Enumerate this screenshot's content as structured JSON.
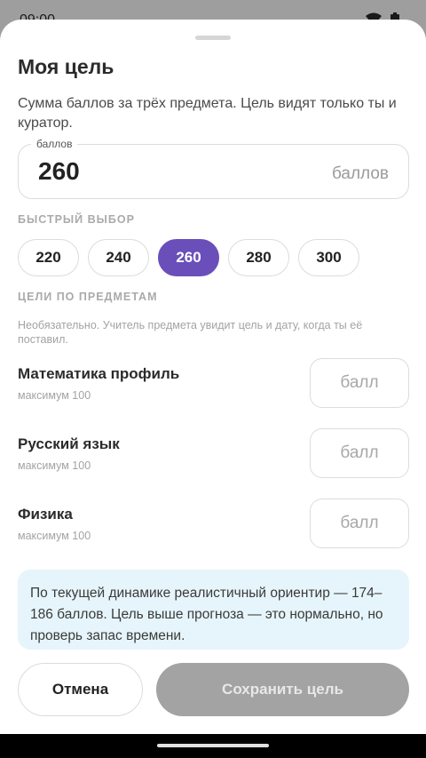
{
  "status_bar": {
    "time": "09:00",
    "icons": [
      "wifi-icon",
      "battery-icon"
    ]
  },
  "sheet": {
    "title": "Моя цель",
    "description": "Сумма баллов за трёх предмета. Цель видят только ты и куратор.",
    "score_field": {
      "legend": "баллов",
      "value": "260",
      "suffix": "баллов"
    },
    "quick_select": {
      "label": "БЫСТРЫЙ ВЫБОР",
      "options": [
        "220",
        "240",
        "260",
        "280",
        "300"
      ],
      "selected": "260"
    },
    "subjects_section": {
      "label": "ЦЕЛИ ПО ПРЕДМЕТАМ",
      "note": "Необязательно. Учитель предмета увидит цель и дату, когда ты её поставил.",
      "subjects": [
        {
          "name": "Математика профиль",
          "max": "максимум 100",
          "placeholder": "балл"
        },
        {
          "name": "Русский язык",
          "max": "максимум 100",
          "placeholder": "балл"
        },
        {
          "name": "Физика",
          "max": "максимум 100",
          "placeholder": "балл"
        }
      ]
    },
    "info_text": "По текущей динамике реалистичный ориентир — 174–186 баллов. Цель выше прогноза — это нормально, но проверь запас времени.",
    "cancel_label": "Отмена",
    "save_label": "Сохранить цель"
  },
  "colors": {
    "accent": "#6a4fba",
    "info_bg": "#e6f5fb",
    "disabled": "#a3a3a3"
  }
}
